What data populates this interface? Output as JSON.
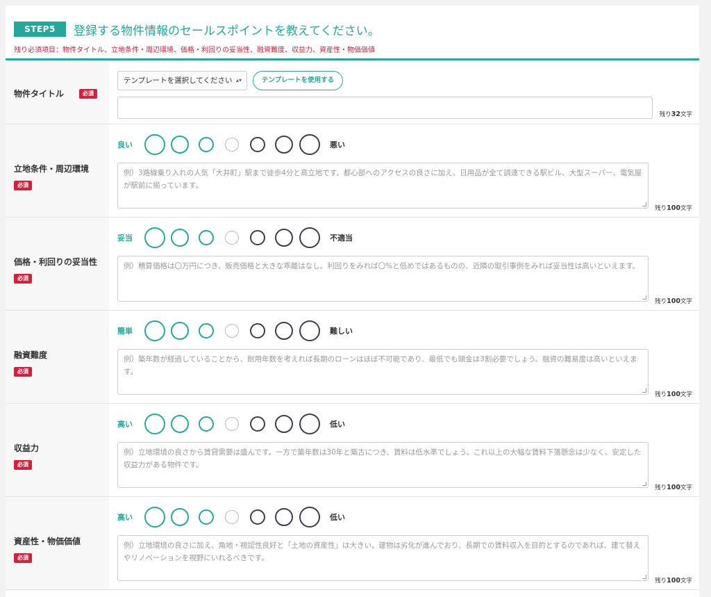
{
  "header": {
    "step": "STEP5",
    "title": "登録する物件情報のセールスポイントを教えてください。",
    "required_note": "残り必須項目：物件タイトル、立地条件・周辺環境、価格・利回りの妥当性、融資難度、収益力、資産性・物価価値"
  },
  "title_row": {
    "label": "物件タイトル",
    "required": "必須",
    "select_value": "テンプレートを選択してください",
    "template_button": "テンプレートを使用する",
    "input_value": "",
    "remain_prefix": "残り",
    "remain_count": "32",
    "remain_suffix": "文字"
  },
  "rows": [
    {
      "label": "立地条件・周辺環境",
      "required": "必須",
      "left": "良い",
      "right": "悪い",
      "placeholder": "例）3路線乗り入れの人気「大井町」駅まで徒歩4分と高立地です。都心部へのアクセスの良さに加え、日用品が全て調達できる駅ビル、大型スーパー、電気屋が駅前に揃っています。",
      "remain_prefix": "残り",
      "remain_count": "100",
      "remain_suffix": "文字"
    },
    {
      "label": "価格・利回りの妥当性",
      "required": "必須",
      "left": "妥当",
      "right": "不適当",
      "placeholder": "例）積算価格は〇万円につき、販売価格と大きな乖離はなし。利回りをみれば〇%と低めではあるものの、近隣の取引事例をみれば妥当性は高いといえます。",
      "remain_prefix": "残り",
      "remain_count": "100",
      "remain_suffix": "文字"
    },
    {
      "label": "融資難度",
      "required": "必須",
      "left": "簡単",
      "right": "難しい",
      "placeholder": "例）築年数が経過していることから、耐用年数を考えれば長期のローンはほぼ不可能であり、最低でも頭金は3割必要でしょう。融資の難易度は高いといえます。",
      "remain_prefix": "残り",
      "remain_count": "100",
      "remain_suffix": "文字"
    },
    {
      "label": "収益力",
      "required": "必須",
      "left": "高い",
      "right": "低い",
      "placeholder": "例）立地環境の良さから賃貸需要は盛んです。一方で築年数は30年と築古につき、賃料は低水準でしょう。これ以上の大幅な賃料下落懸念は少なく、安定した収益力がある物件です。",
      "remain_prefix": "残り",
      "remain_count": "100",
      "remain_suffix": "文字"
    },
    {
      "label": "資産性・物価価値",
      "required": "必須",
      "left": "高い",
      "right": "低い",
      "placeholder": "例）立地環境の良さに加え、角地・視認性良好と「土地の資産性」は大きい。建物は劣化が進んでおり、長期での賃料収入を目的とするのであれば、建て替えやリノベーションを視野にいれるべきです。",
      "remain_prefix": "残り",
      "remain_count": "100",
      "remain_suffix": "文字"
    }
  ]
}
